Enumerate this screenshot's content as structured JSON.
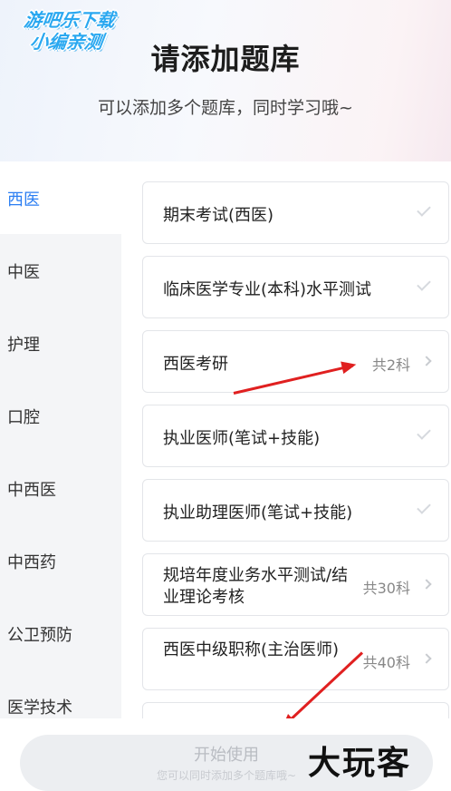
{
  "watermark": {
    "line1": "游吧乐下载",
    "line2": "小编亲测"
  },
  "header": {
    "title": "请添加题库",
    "subtitle": "可以添加多个题库，同时学习哦~"
  },
  "sidebar": {
    "items": [
      {
        "label": "西医",
        "active": true
      },
      {
        "label": "中医"
      },
      {
        "label": "护理"
      },
      {
        "label": "口腔"
      },
      {
        "label": "中西医"
      },
      {
        "label": "中西药"
      },
      {
        "label": "公卫预防"
      },
      {
        "label": "医学技术"
      }
    ]
  },
  "cards": [
    {
      "label": "期末考试(西医)",
      "type": "check"
    },
    {
      "label": "临床医学专业(本科)水平测试",
      "type": "check"
    },
    {
      "label": "西医考研",
      "count": "共2科",
      "type": "more"
    },
    {
      "label": "执业医师(笔试+技能)",
      "type": "check"
    },
    {
      "label": "执业助理医师(笔试+技能)",
      "type": "check"
    },
    {
      "label": "规培年度业务水平测试/结业理论考核",
      "count": "共30科",
      "type": "more"
    },
    {
      "label": "西医中级职称(主治医师)",
      "count": "共40科",
      "type": "more"
    }
  ],
  "bottom": {
    "start_label": "开始使用",
    "start_hint": "您可以同时添加多个题库哦~",
    "brand_mark": "大玩客"
  },
  "colors": {
    "accent": "#2b7ef2",
    "annotation_arrow": "#e02020"
  }
}
